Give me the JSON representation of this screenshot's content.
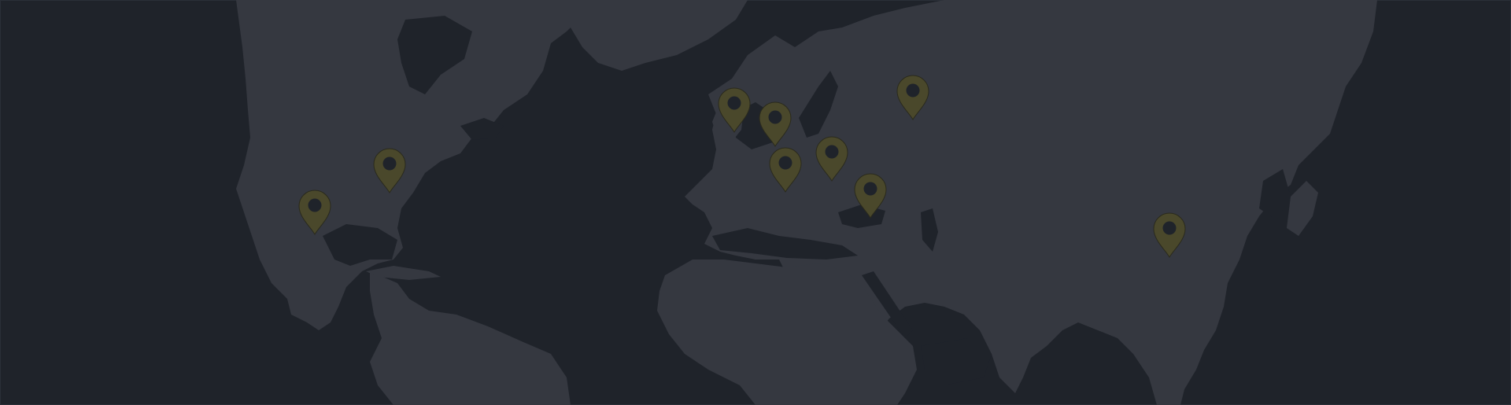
{
  "map": {
    "theme": "dark",
    "colors": {
      "ocean": "#1f232a",
      "land": "#353840",
      "pin": "#4a482b",
      "pin_dot": "#1f232a"
    },
    "markers": [
      {
        "id": "mexico",
        "icon": "map-pin-icon"
      },
      {
        "id": "united-states",
        "icon": "map-pin-icon"
      },
      {
        "id": "united-kingdom",
        "icon": "map-pin-icon"
      },
      {
        "id": "germany",
        "icon": "map-pin-icon"
      },
      {
        "id": "switzerland",
        "icon": "map-pin-icon"
      },
      {
        "id": "hungary",
        "icon": "map-pin-icon"
      },
      {
        "id": "bulgaria",
        "icon": "map-pin-icon"
      },
      {
        "id": "russia",
        "icon": "map-pin-icon"
      },
      {
        "id": "china",
        "icon": "map-pin-icon"
      }
    ]
  }
}
